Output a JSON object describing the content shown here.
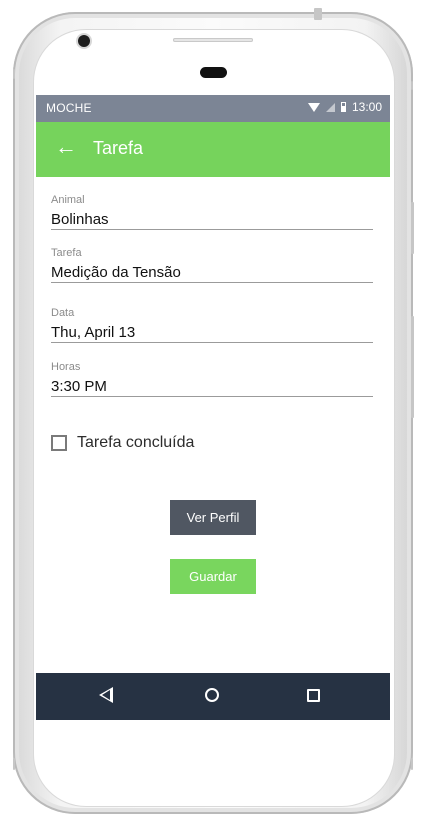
{
  "status_bar": {
    "carrier": "MOCHE",
    "time": "13:00",
    "icons": [
      "wifi-icon",
      "signal-icon",
      "battery-icon"
    ],
    "color": "#7c8595"
  },
  "app_bar": {
    "title": "Tarefa",
    "back_icon": "←",
    "color": "#76d35c"
  },
  "form": {
    "fields": [
      {
        "label": "Animal",
        "value": "Bolinhas"
      },
      {
        "label": "Tarefa",
        "value": "Medição da Tensão"
      },
      {
        "label": "Data",
        "value": "Thu, April 13"
      },
      {
        "label": "Horas",
        "value": "3:30 PM"
      }
    ],
    "checkbox": {
      "label": "Tarefa concluída",
      "checked": false
    }
  },
  "buttons": {
    "profile": "Ver Perfil",
    "save": "Guardar"
  },
  "navigation": {
    "icons": [
      "back-icon",
      "home-icon",
      "recents-icon"
    ],
    "color": "#263243"
  }
}
